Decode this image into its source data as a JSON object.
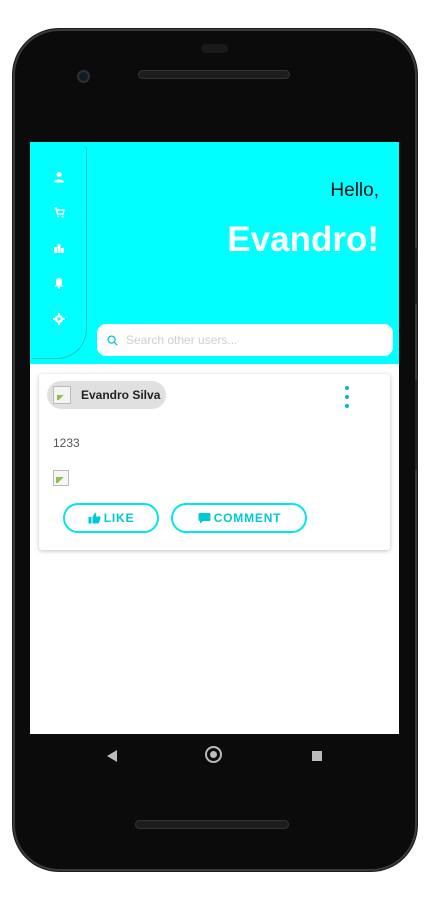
{
  "header": {
    "greeting": "Hello,",
    "user_name": "Evandro!"
  },
  "side_nav": {
    "items": [
      {
        "icon": "person-icon"
      },
      {
        "icon": "cart-icon"
      },
      {
        "icon": "chart-icon"
      },
      {
        "icon": "bell-icon"
      },
      {
        "icon": "gear-icon"
      }
    ]
  },
  "search": {
    "placeholder": "Search other users...",
    "icon": "search-icon"
  },
  "post": {
    "author": "Evandro Silva",
    "text": "1233",
    "like_label": "LIKE",
    "comment_label": "COMMENT"
  },
  "colors": {
    "accent": "#00ffff",
    "button_border": "#00e5f0",
    "button_text": "#00c8d6"
  },
  "system_nav": [
    "back-icon",
    "home-icon",
    "recent-apps-icon"
  ]
}
